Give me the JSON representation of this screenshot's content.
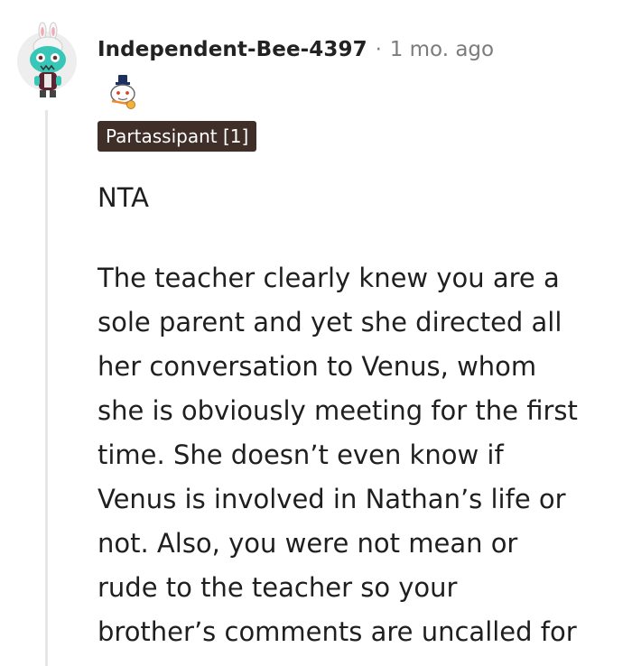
{
  "comment": {
    "author": "Independent-Bee-4397",
    "separator": "·",
    "time_ago": "1 mo. ago",
    "flair": "Partassipant [1]",
    "paragraph_1": "NTA",
    "paragraph_2_lines": [
      "The teacher clearly knew you are a",
      "sole parent and yet she directed all",
      "her conversation to Venus, whom",
      "she is obviously meeting for the first",
      "time. She doesn’t even know if",
      "Venus is involved in Nathan’s life or",
      "not. Also, you were not mean or",
      "rude to the teacher so your",
      "brother’s comments are uncalled for"
    ]
  },
  "icons": {
    "avatar": "snoo-avatar-icon",
    "award": "award-icon"
  },
  "colors": {
    "flair_bg": "#3f2f28",
    "meta_gray": "#7c7c7c",
    "thread_line": "#e6e6e6"
  }
}
